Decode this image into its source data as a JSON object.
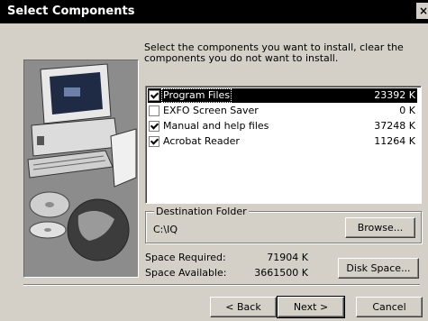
{
  "window": {
    "title": "Select Components",
    "close_glyph": "×"
  },
  "instructions": "Select the components you want to install, clear the components you do not want to install.",
  "components": [
    {
      "name": "Program Files",
      "size": "23392 K",
      "checked": true,
      "selected": true
    },
    {
      "name": "EXFO Screen Saver",
      "size": "0 K",
      "checked": false,
      "selected": false
    },
    {
      "name": "Manual and help files",
      "size": "37248 K",
      "checked": true,
      "selected": false
    },
    {
      "name": "Acrobat Reader",
      "size": "11264 K",
      "checked": true,
      "selected": false
    }
  ],
  "destination": {
    "label": "Destination Folder",
    "path": "C:\\IQ",
    "browse_label": "Browse..."
  },
  "space": {
    "required_label": "Space Required:",
    "required_value": "71904 K",
    "available_label": "Space Available:",
    "available_value": "3661500 K",
    "disk_space_label": "Disk Space..."
  },
  "buttons": {
    "back": "< Back",
    "next": "Next >",
    "cancel": "Cancel"
  },
  "graphic": {
    "icons": [
      "computer-icon",
      "cd-disc-icon",
      "globe-icon",
      "book-icon"
    ]
  }
}
